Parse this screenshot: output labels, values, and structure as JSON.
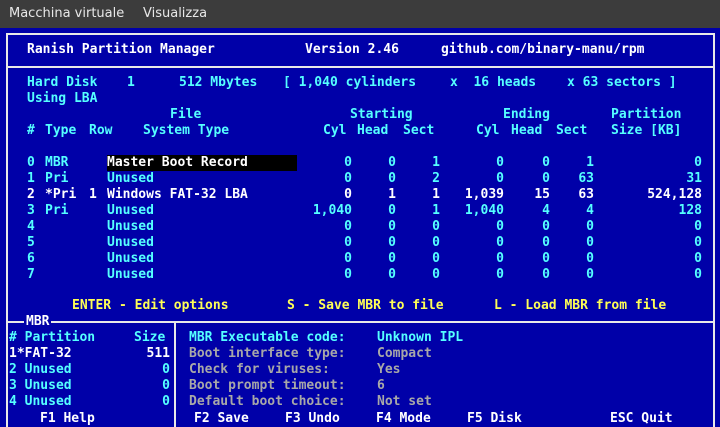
{
  "menubar": {
    "items": [
      "Macchina virtuale",
      "Visualizza"
    ]
  },
  "title": {
    "app": "Ranish Partition Manager",
    "version": "Version 2.46",
    "url": "github.com/binary-manu/rpm"
  },
  "disk": {
    "label": "Hard Disk",
    "number": "1",
    "size": "512 Mbytes",
    "cylinders": "[ 1,040 cylinders",
    "heads": "x  16 heads",
    "sectors": "x 63 sectors ]",
    "mode": "Using LBA"
  },
  "columns": {
    "file": "File",
    "starting": "Starting",
    "ending": "Ending",
    "partition": "Partition",
    "num": "#",
    "type": "Type",
    "row": "Row",
    "fs": "System Type",
    "cyl": "Cyl",
    "head": "Head",
    "sect": "Sect",
    "size": "Size [KB]"
  },
  "partitions": [
    {
      "num": "0",
      "type": "MBR",
      "row": "",
      "fs": "Master Boot Record",
      "sc": "0",
      "sh": "0",
      "ss": "1",
      "ec": "0",
      "eh": "0",
      "es": "1",
      "size": "0"
    },
    {
      "num": "1",
      "type": "Pri",
      "row": "",
      "fs": "Unused",
      "sc": "0",
      "sh": "0",
      "ss": "2",
      "ec": "0",
      "eh": "0",
      "es": "63",
      "size": "31"
    },
    {
      "num": "2",
      "type": "*Pri",
      "row": "1",
      "fs": "Windows FAT-32 LBA",
      "sc": "0",
      "sh": "1",
      "ss": "1",
      "ec": "1,039",
      "eh": "15",
      "es": "63",
      "size": "524,128"
    },
    {
      "num": "3",
      "type": "Pri",
      "row": "",
      "fs": "Unused",
      "sc": "1,040",
      "sh": "0",
      "ss": "1",
      "ec": "1,040",
      "eh": "4",
      "es": "4",
      "size": "128"
    },
    {
      "num": "4",
      "type": "",
      "row": "",
      "fs": "Unused",
      "sc": "0",
      "sh": "0",
      "ss": "0",
      "ec": "0",
      "eh": "0",
      "es": "0",
      "size": "0"
    },
    {
      "num": "5",
      "type": "",
      "row": "",
      "fs": "Unused",
      "sc": "0",
      "sh": "0",
      "ss": "0",
      "ec": "0",
      "eh": "0",
      "es": "0",
      "size": "0"
    },
    {
      "num": "6",
      "type": "",
      "row": "",
      "fs": "Unused",
      "sc": "0",
      "sh": "0",
      "ss": "0",
      "ec": "0",
      "eh": "0",
      "es": "0",
      "size": "0"
    },
    {
      "num": "7",
      "type": "",
      "row": "",
      "fs": "Unused",
      "sc": "0",
      "sh": "0",
      "ss": "0",
      "ec": "0",
      "eh": "0",
      "es": "0",
      "size": "0"
    }
  ],
  "hints": {
    "enter": "ENTER - Edit options",
    "save": "S - Save MBR to file",
    "load": "L - Load MBR from file"
  },
  "mbr": {
    "title": "MBR",
    "header_partition": "# Partition",
    "header_size": "Size",
    "rows": [
      {
        "label": "1*FAT-32",
        "size": "511"
      },
      {
        "label": "2 Unused",
        "size": "0"
      },
      {
        "label": "3 Unused",
        "size": "0"
      },
      {
        "label": "4 Unused",
        "size": "0"
      }
    ]
  },
  "options": [
    {
      "label": "MBR Executable code:",
      "value": "Unknown IPL"
    },
    {
      "label": "Boot interface type:",
      "value": "Compact"
    },
    {
      "label": "Check for viruses:",
      "value": "Yes"
    },
    {
      "label": "Boot prompt timeout:",
      "value": "6"
    },
    {
      "label": "Default boot choice:",
      "value": "Not set"
    }
  ],
  "fkeys": {
    "f1": "F1 Help",
    "f2": "F2 Save",
    "f3": "F3 Undo",
    "f4": "F4 Mode",
    "f5": "F5 Disk",
    "esc": "ESC Quit"
  },
  "colors": {
    "background": "#0000a8",
    "highlight": "#ffff55",
    "cyan": "#55ffff",
    "disabled": "#a8a8a8",
    "menubar": "#3c3c3c"
  }
}
